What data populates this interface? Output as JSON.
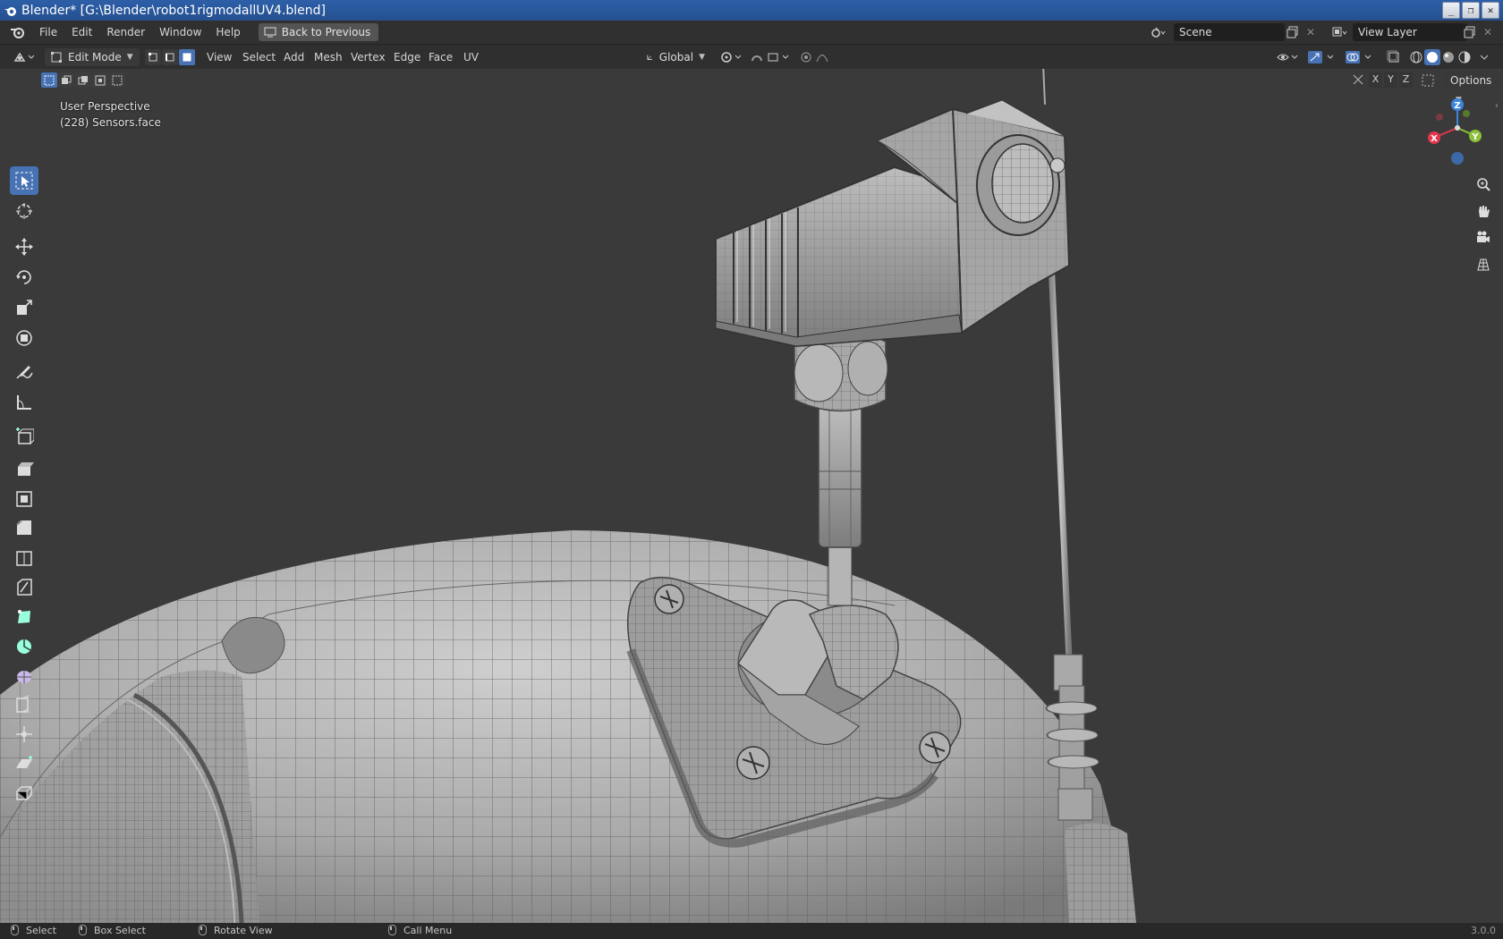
{
  "window": {
    "title": "Blender* [G:\\Blender\\robot1rigmodallUV4.blend]",
    "buttons": [
      "_",
      "❐",
      "✕"
    ]
  },
  "topbar": {
    "menus": [
      "File",
      "Edit",
      "Render",
      "Window",
      "Help"
    ],
    "back_button": "Back to Previous",
    "scene": "Scene",
    "view_layer": "View Layer"
  },
  "header": {
    "mode": "Edit Mode",
    "menus": [
      "View",
      "Select",
      "Add",
      "Mesh",
      "Vertex",
      "Edge",
      "Face",
      "UV"
    ],
    "transform_orientation": "Global",
    "options_label": "Options",
    "axes": [
      "X",
      "Y",
      "Z"
    ]
  },
  "viewport": {
    "perspective": "User Perspective",
    "object_info": "(228) Sensors.face",
    "gizmo": {
      "x": "X",
      "y": "Y",
      "z": "Z"
    }
  },
  "toolbar": {
    "tools": [
      "select-box",
      "cursor",
      "move",
      "rotate",
      "scale",
      "transform",
      "annotate",
      "measure",
      "add-cube",
      "extrude-region",
      "inset-faces",
      "bevel",
      "loop-cut",
      "knife",
      "poly-build",
      "spin",
      "smooth",
      "edge-slide",
      "shrink-fatten",
      "shear",
      "rip-region"
    ]
  },
  "status": {
    "select": "Select",
    "box_select": "Box Select",
    "rotate_view": "Rotate View",
    "call_menu": "Call Menu",
    "version": "3.0.0"
  },
  "colors": {
    "accent": "#4772b3",
    "titlebar": "#2d5fa8",
    "viewport_bg": "#3a3a3a",
    "axis_x": "#e2374c",
    "axis_y": "#8bc13b",
    "axis_z": "#3c85dd"
  }
}
